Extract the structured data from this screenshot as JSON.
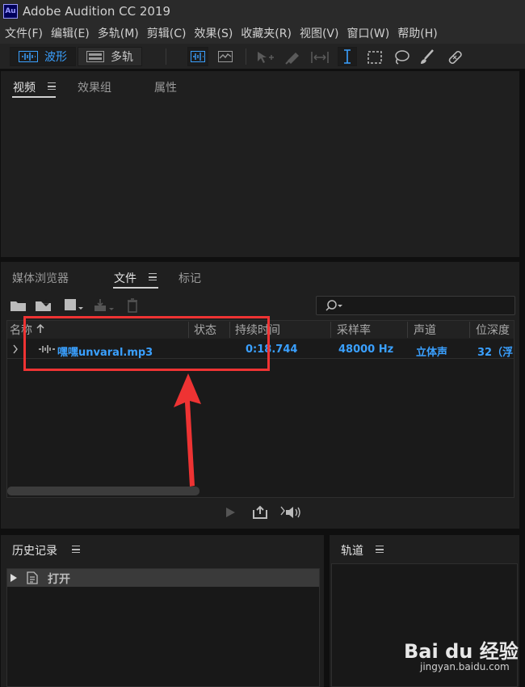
{
  "app": {
    "logo_text": "Au",
    "title": "Adobe Audition CC 2019"
  },
  "menu": [
    {
      "label": "文件(F)"
    },
    {
      "label": "编辑(E)"
    },
    {
      "label": "多轨(M)"
    },
    {
      "label": "剪辑(C)"
    },
    {
      "label": "效果(S)"
    },
    {
      "label": "收藏夹(R)"
    },
    {
      "label": "视图(V)"
    },
    {
      "label": "窗口(W)"
    },
    {
      "label": "帮助(H)"
    }
  ],
  "toolbar": {
    "waveform_label": "波形",
    "multitrack_label": "多轨"
  },
  "top_panel": {
    "tabs": [
      "视频",
      "效果组",
      "属性"
    ]
  },
  "files_panel": {
    "tabs": [
      "媒体浏览器",
      "文件",
      "标记"
    ],
    "columns": {
      "name": "名称",
      "status": "状态",
      "duration": "持续时间",
      "sample_rate": "采样率",
      "channels": "声道",
      "bit_depth": "位深度"
    },
    "rows": [
      {
        "name": "嘿嘿unvaral.mp3",
        "status": "",
        "duration": "0:18.744",
        "sample_rate": "48000 Hz",
        "channels": "立体声",
        "bit_depth": "32（浮"
      }
    ]
  },
  "history_panel": {
    "title": "历史记录",
    "items": [
      {
        "label": "打开"
      }
    ]
  },
  "tracks_panel": {
    "title": "轨道"
  },
  "watermark": {
    "brand": "Bai du 经验",
    "url": "jingyan.baidu.com"
  },
  "colors": {
    "accent_blue": "#3aa0ff",
    "annotation_red": "#ee3333",
    "panel_bg": "#1f1f1f"
  }
}
